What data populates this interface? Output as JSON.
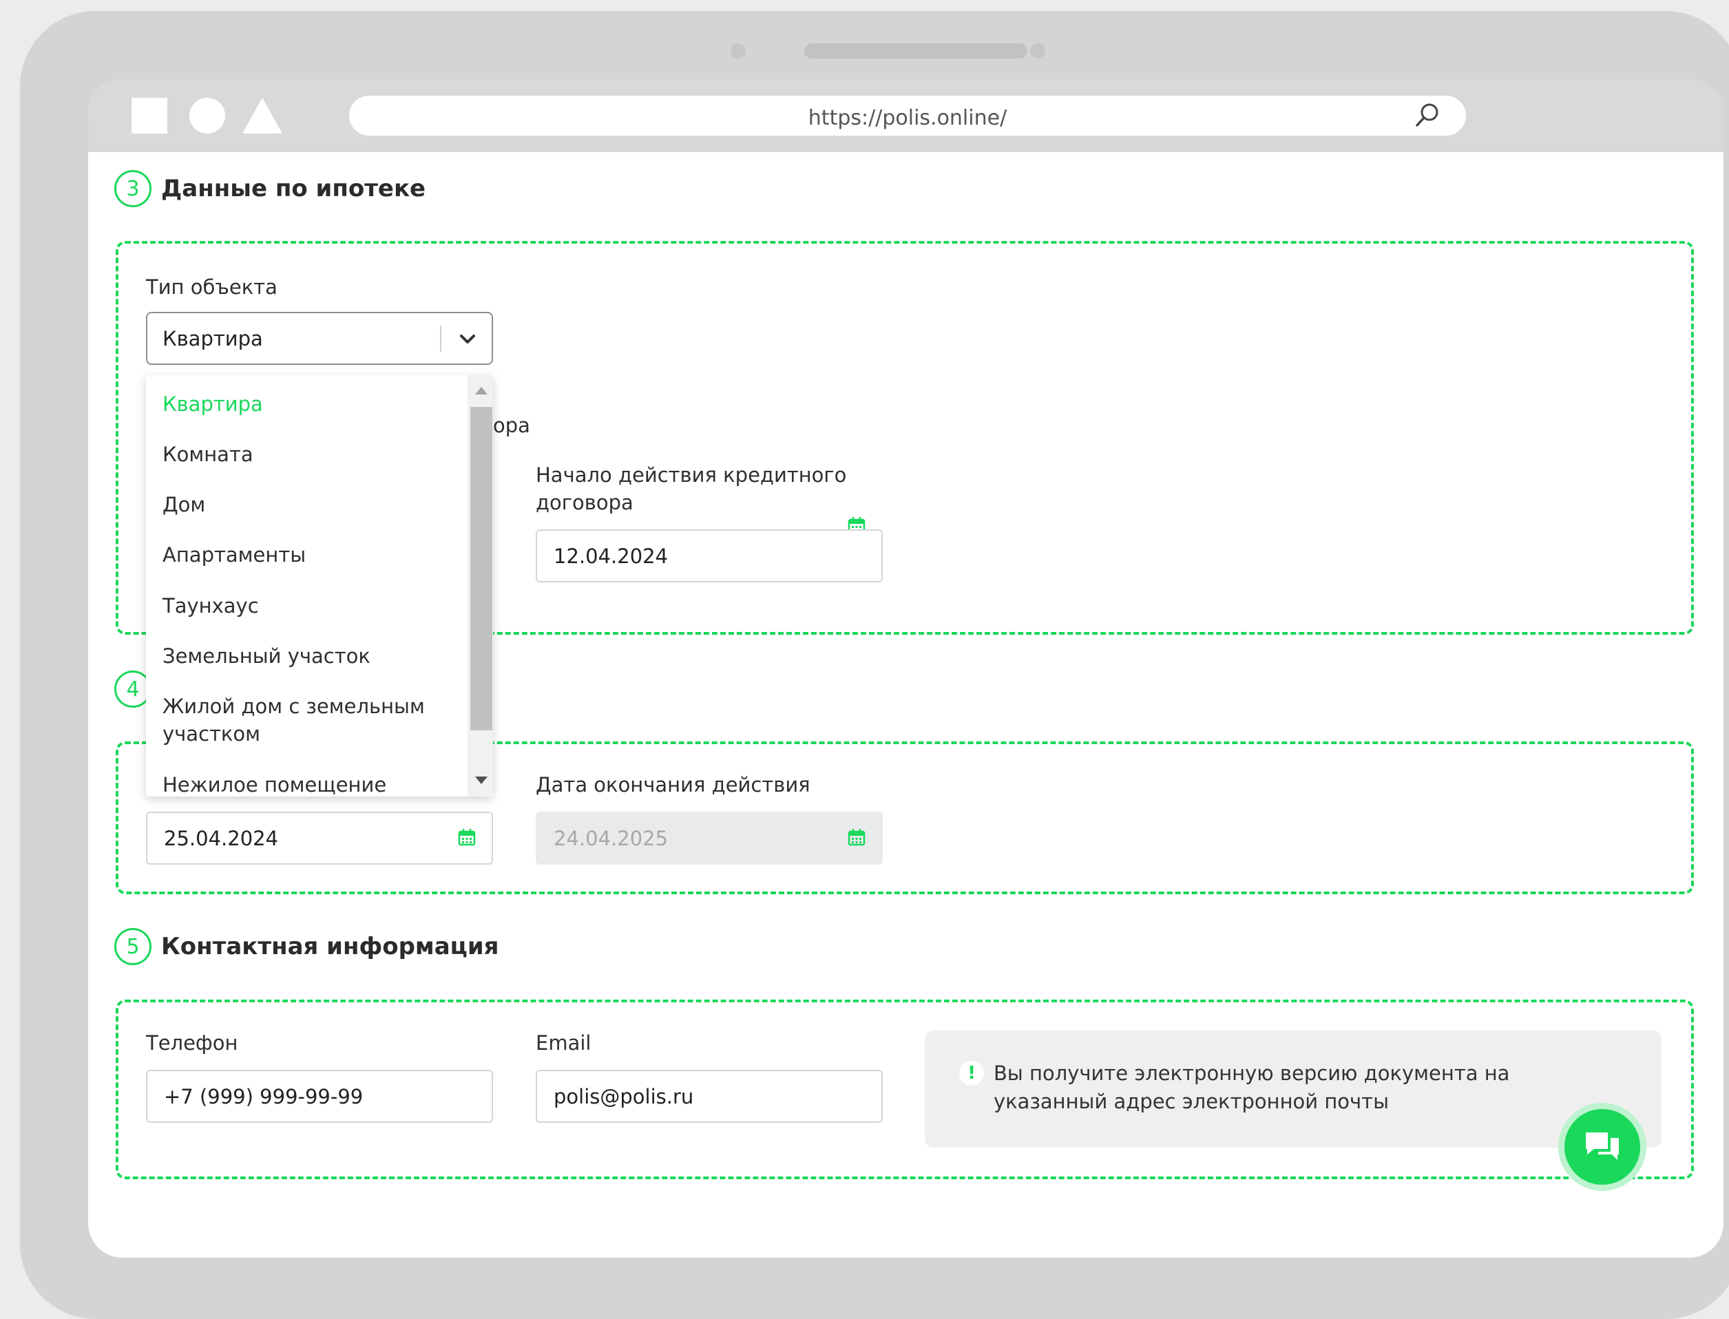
{
  "browser": {
    "url": "https://polis.online/",
    "window_shapes": [
      "square-icon",
      "circle-icon",
      "triangle-icon"
    ]
  },
  "section3": {
    "number": "3",
    "title": "Данные по ипотеке",
    "object_type_label": "Тип объекта",
    "object_type_value": "Квартира",
    "hidden_label_fragment": "ора",
    "credit_start_label": "Начало действия кредитного договора",
    "credit_start_value": "12.04.2024",
    "dropdown_options": [
      "Квартира",
      "Комната",
      "Дом",
      "Апартаменты",
      "Таунхаус",
      "Земельный участок",
      "Жилой дом с земельным участком",
      "Нежилое помещение"
    ]
  },
  "section4": {
    "number": "4",
    "start_value": "25.04.2024",
    "end_label": "Дата окончания действия",
    "end_value": "24.04.2025"
  },
  "section5": {
    "number": "5",
    "title": "Контактная информация",
    "phone_label": "Телефон",
    "phone_value": "+7 (999) 999-99-99",
    "email_label": "Email",
    "email_value": "polis@polis.ru",
    "notice_icon": "!",
    "notice_text": "Вы получите электронную версию документа на указанный адрес электронной почты"
  },
  "colors": {
    "accent": "#19d85a",
    "frame": "#d4d4d4",
    "disabled_input": "#e9eaeb"
  }
}
